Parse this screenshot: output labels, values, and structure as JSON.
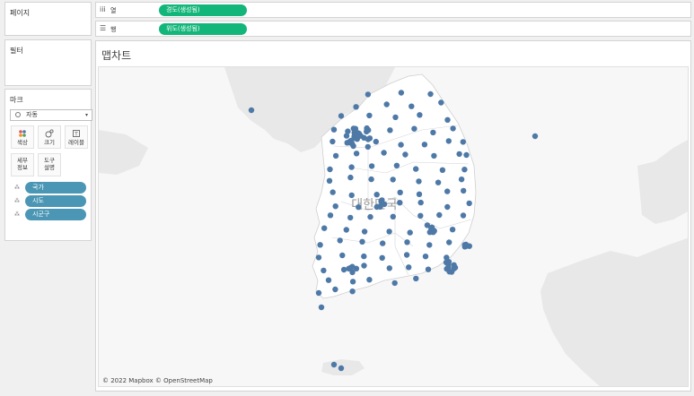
{
  "left_panel": {
    "pages_title": "페이지",
    "filters_title": "필터",
    "marks_title": "마크",
    "mark_type": "자동",
    "mark_buttons": {
      "color": "색상",
      "size": "크기",
      "label": "레이블",
      "detail": "세부\n정보",
      "tooltip": "도구\n설명"
    },
    "detail_pills": [
      "국가",
      "시도",
      "시군구"
    ]
  },
  "shelves": {
    "columns_label": "열",
    "columns_pill": "경도(생성됨)",
    "rows_label": "행",
    "rows_pill": "위도(생성됨)"
  },
  "sheet": {
    "title": "맵차트",
    "country_label": "대한민국",
    "credit": "© 2022 Mapbox © OpenStreetMap"
  },
  "colors": {
    "green_pill": "#13b67a",
    "blue_pill": "#4a96b4",
    "mark": "#4e79a7",
    "land_korea": "#ffffff",
    "land_other": "#e8e8e8",
    "sea": "#f7f7f7"
  }
}
